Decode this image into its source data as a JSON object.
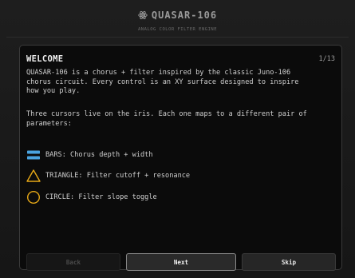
{
  "header": {
    "title": "QUASAR-106",
    "subtitle": "ANALOG COLOR FILTER ENGINE",
    "logo_icon": "atom-icon"
  },
  "panel": {
    "title": "WELCOME",
    "page": "1/13",
    "paragraph_1": "QUASAR-106 is a chorus + filter inspired by the classic Juno-106\nchorus circuit. Every control is an XY surface designed to inspire\nhow you play.",
    "paragraph_2": "Three cursors live on the iris. Each one maps to a different pair of\nparameters:",
    "legend": [
      {
        "icon": "bars-icon",
        "color": "#4aa3df",
        "label": "BARS: Chorus depth + width"
      },
      {
        "icon": "triangle-icon",
        "color": "#e6a817",
        "label": "TRIANGLE: Filter cutoff + resonance"
      },
      {
        "icon": "circle-icon",
        "color": "#e6a817",
        "label": "CIRCLE: Filter slope toggle"
      }
    ]
  },
  "buttons": {
    "back": "Back",
    "next": "Next",
    "skip": "Skip"
  }
}
